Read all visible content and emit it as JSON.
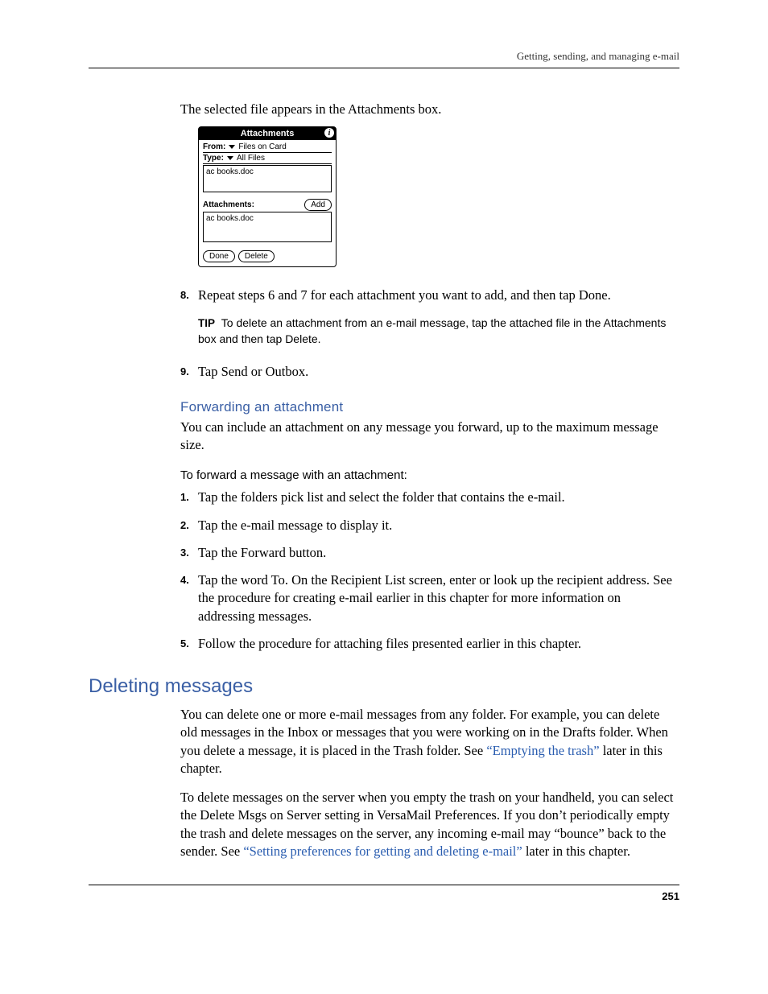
{
  "header": {
    "running": "Getting, sending, and managing e-mail"
  },
  "intro": "The selected file appears in the Attachments box.",
  "palm": {
    "title": "Attachments",
    "info_glyph": "i",
    "from_label": "From:",
    "from_value": "Files on Card",
    "type_label": "Type:",
    "type_value": "All Files",
    "filelist_item": "ac books.doc",
    "attachments_label": "Attachments:",
    "add_btn": "Add",
    "attach_item": "ac books.doc",
    "done_btn": "Done",
    "delete_btn": "Delete"
  },
  "step8": {
    "num": "8.",
    "text": "Repeat steps 6 and 7 for each attachment you want to add, and then tap Done."
  },
  "tip": {
    "label": "TIP",
    "text": "To delete an attachment from an e-mail message, tap the attached file in the Attachments box and then tap Delete."
  },
  "step9": {
    "num": "9.",
    "text": "Tap Send or Outbox."
  },
  "section_forward": {
    "heading": "Forwarding an attachment",
    "para": "You can include an attachment on any message you forward, up to the maximum message size.",
    "subhead": "To forward a message with an attachment:",
    "steps": [
      {
        "num": "1.",
        "text": "Tap the folders pick list and select the folder that contains the e-mail."
      },
      {
        "num": "2.",
        "text": "Tap the e-mail message to display it."
      },
      {
        "num": "3.",
        "text": "Tap the Forward button."
      },
      {
        "num": "4.",
        "text": "Tap the word To. On the Recipient List screen, enter or look up the recipient address. See the procedure for creating e-mail earlier in this chapter for more information on addressing messages."
      },
      {
        "num": "5.",
        "text": "Follow the procedure for attaching files presented earlier in this chapter."
      }
    ]
  },
  "section_delete": {
    "heading": "Deleting messages",
    "p1a": "You can delete one or more e-mail messages from any folder. For example, you can delete old messages in the Inbox or messages that you were working on in the Drafts folder. When you delete a message, it is placed in the Trash folder. See ",
    "p1link": "“Emptying the trash”",
    "p1b": " later in this chapter.",
    "p2a": "To delete messages on the server when you empty the trash on your handheld, you can select the Delete Msgs on Server setting in VersaMail Preferences. If you don’t periodically empty the trash and delete messages on the server, any incoming e-mail may “bounce” back to the sender. See ",
    "p2link": "“Setting preferences for getting and deleting e-mail”",
    "p2b": " later in this chapter."
  },
  "pagenum": "251"
}
